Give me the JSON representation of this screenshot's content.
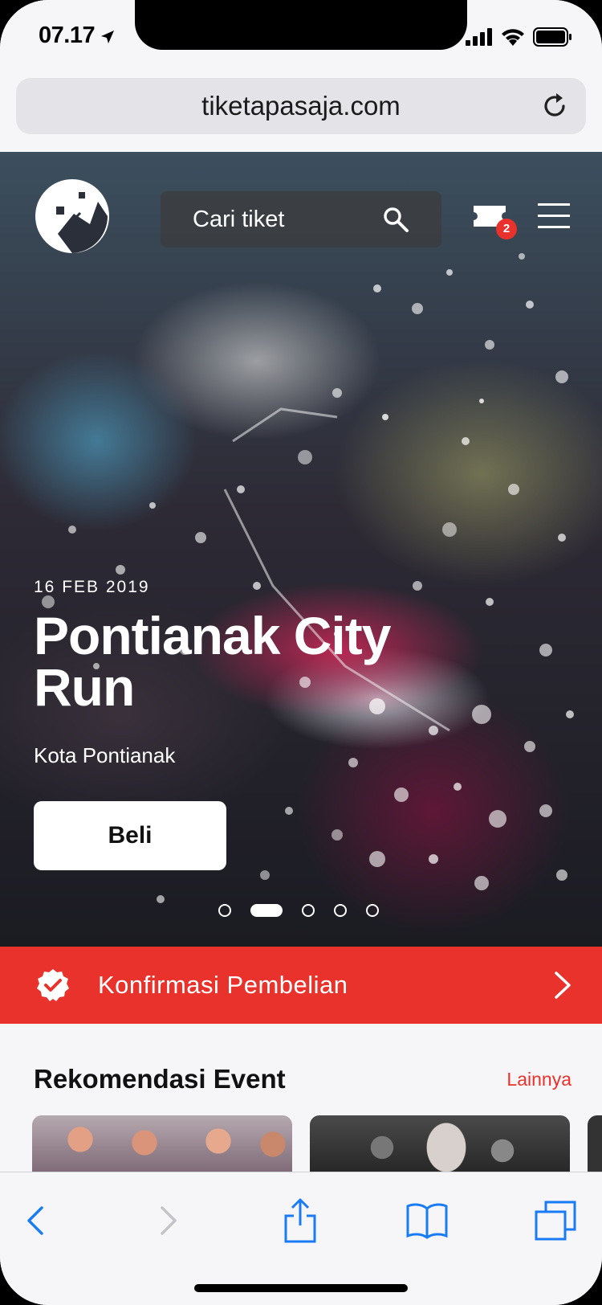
{
  "status_bar": {
    "time": "07.17",
    "icons": [
      "location-arrow-icon",
      "signal-icon",
      "wifi-icon",
      "battery-icon"
    ]
  },
  "browser": {
    "url": "tiketapasaja.com",
    "reload_icon": "reload-icon"
  },
  "header": {
    "logo_icon": "brand-logo",
    "search_placeholder": "Cari tiket",
    "cart_badge_count": "2",
    "icons": [
      "search-icon",
      "ticket-icon",
      "menu-icon"
    ]
  },
  "hero": {
    "date": "16 FEB 2019",
    "title": "Pontianak City Run",
    "location": "Kota Pontianak",
    "buy_label": "Beli",
    "slides_total": 5,
    "active_slide": 2
  },
  "confirm_bar": {
    "label": "Konfirmasi Pembelian",
    "icon": "verified-badge-icon",
    "chevron_icon": "chevron-right-icon"
  },
  "recommendations": {
    "title": "Rekomendasi Event",
    "more_label": "Lainnya"
  },
  "toolbar": {
    "icons": [
      "back-icon",
      "forward-icon",
      "share-icon",
      "bookmarks-icon",
      "tabs-icon"
    ]
  },
  "colors": {
    "brand_red": "#e8322b",
    "ios_blue": "#1a7cf4",
    "background": "#f6f6f8"
  }
}
